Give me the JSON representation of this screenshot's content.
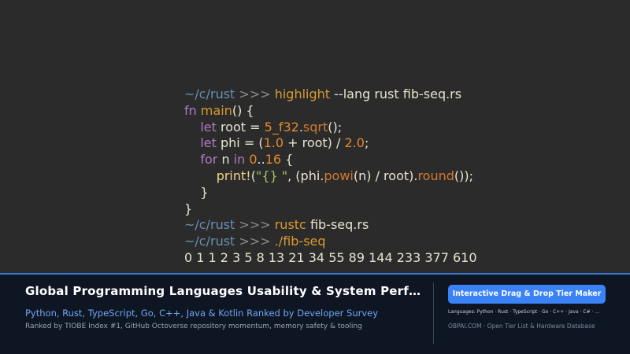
{
  "terminal": {
    "lines": [
      {
        "segments": [
          {
            "t": "~/c/rust ",
            "c": "path"
          },
          {
            "t": ">>> ",
            "c": "prompt"
          },
          {
            "t": "highlight ",
            "c": "cmd"
          },
          {
            "t": "--lang rust fib-seq.rs",
            "c": "plain"
          }
        ]
      },
      {
        "segments": [
          {
            "t": "fn ",
            "c": "kw"
          },
          {
            "t": "main",
            "c": "fn"
          },
          {
            "t": "() {",
            "c": "plain"
          }
        ]
      },
      {
        "segments": [
          {
            "t": "    ",
            "c": "plain"
          },
          {
            "t": "let ",
            "c": "kw"
          },
          {
            "t": "root = ",
            "c": "plain"
          },
          {
            "t": "5_f32",
            "c": "num"
          },
          {
            "t": ".",
            "c": "plain"
          },
          {
            "t": "sqrt",
            "c": "call"
          },
          {
            "t": "();",
            "c": "plain"
          }
        ]
      },
      {
        "segments": [
          {
            "t": "    ",
            "c": "plain"
          },
          {
            "t": "let ",
            "c": "kw"
          },
          {
            "t": "phi = (",
            "c": "plain"
          },
          {
            "t": "1.0",
            "c": "num"
          },
          {
            "t": " + root) / ",
            "c": "plain"
          },
          {
            "t": "2.0",
            "c": "num"
          },
          {
            "t": ";",
            "c": "plain"
          }
        ]
      },
      {
        "segments": [
          {
            "t": "    ",
            "c": "plain"
          },
          {
            "t": "for ",
            "c": "kw"
          },
          {
            "t": "n ",
            "c": "plain"
          },
          {
            "t": "in ",
            "c": "kw"
          },
          {
            "t": "0",
            "c": "num"
          },
          {
            "t": "..",
            "c": "plain"
          },
          {
            "t": "16",
            "c": "num"
          },
          {
            "t": " {",
            "c": "plain"
          }
        ]
      },
      {
        "segments": [
          {
            "t": "        ",
            "c": "plain"
          },
          {
            "t": "print!",
            "c": "macro"
          },
          {
            "t": "(",
            "c": "plain"
          },
          {
            "t": "\"{} \"",
            "c": "str"
          },
          {
            "t": ", (phi.",
            "c": "plain"
          },
          {
            "t": "powi",
            "c": "call"
          },
          {
            "t": "(n) / root).",
            "c": "plain"
          },
          {
            "t": "round",
            "c": "call"
          },
          {
            "t": "());",
            "c": "plain"
          }
        ]
      },
      {
        "segments": [
          {
            "t": "    }",
            "c": "plain"
          }
        ]
      },
      {
        "segments": [
          {
            "t": "}",
            "c": "plain"
          }
        ]
      },
      {
        "segments": [
          {
            "t": "~/c/rust ",
            "c": "path"
          },
          {
            "t": ">>> ",
            "c": "prompt"
          },
          {
            "t": "rustc ",
            "c": "cmd"
          },
          {
            "t": "fib-seq.rs",
            "c": "plain"
          }
        ]
      },
      {
        "segments": [
          {
            "t": "~/c/rust ",
            "c": "path"
          },
          {
            "t": ">>> ",
            "c": "prompt"
          },
          {
            "t": "./fib-seq",
            "c": "cmd"
          }
        ]
      },
      {
        "segments": [
          {
            "t": "0 1 1 2 3 5 8 13 21 34 55 89 144 233 377 610",
            "c": "plain"
          }
        ]
      }
    ]
  },
  "banner": {
    "title": "Global Programming Languages Usability & System Perfo...",
    "subtitle": "Python, Rust, TypeScript, Go, C++, Java & Kotlin Ranked by Developer Survey",
    "description": "Ranked by TIOBE Index #1, GitHub Octoverse repository momentum, memory safety & tooling",
    "cta_label": "Interactive Drag & Drop Tier Maker",
    "languages": "Languages: Python · Rust · TypeScript · Go · C++ · Java · C# · ...",
    "footer": "OBPAI.COM · Open Tier List & Hardware Database"
  },
  "colors": {
    "accent": "#3b82f6",
    "banner_bg": "#0e1624",
    "terminal_bg": "#2b2b2b"
  }
}
